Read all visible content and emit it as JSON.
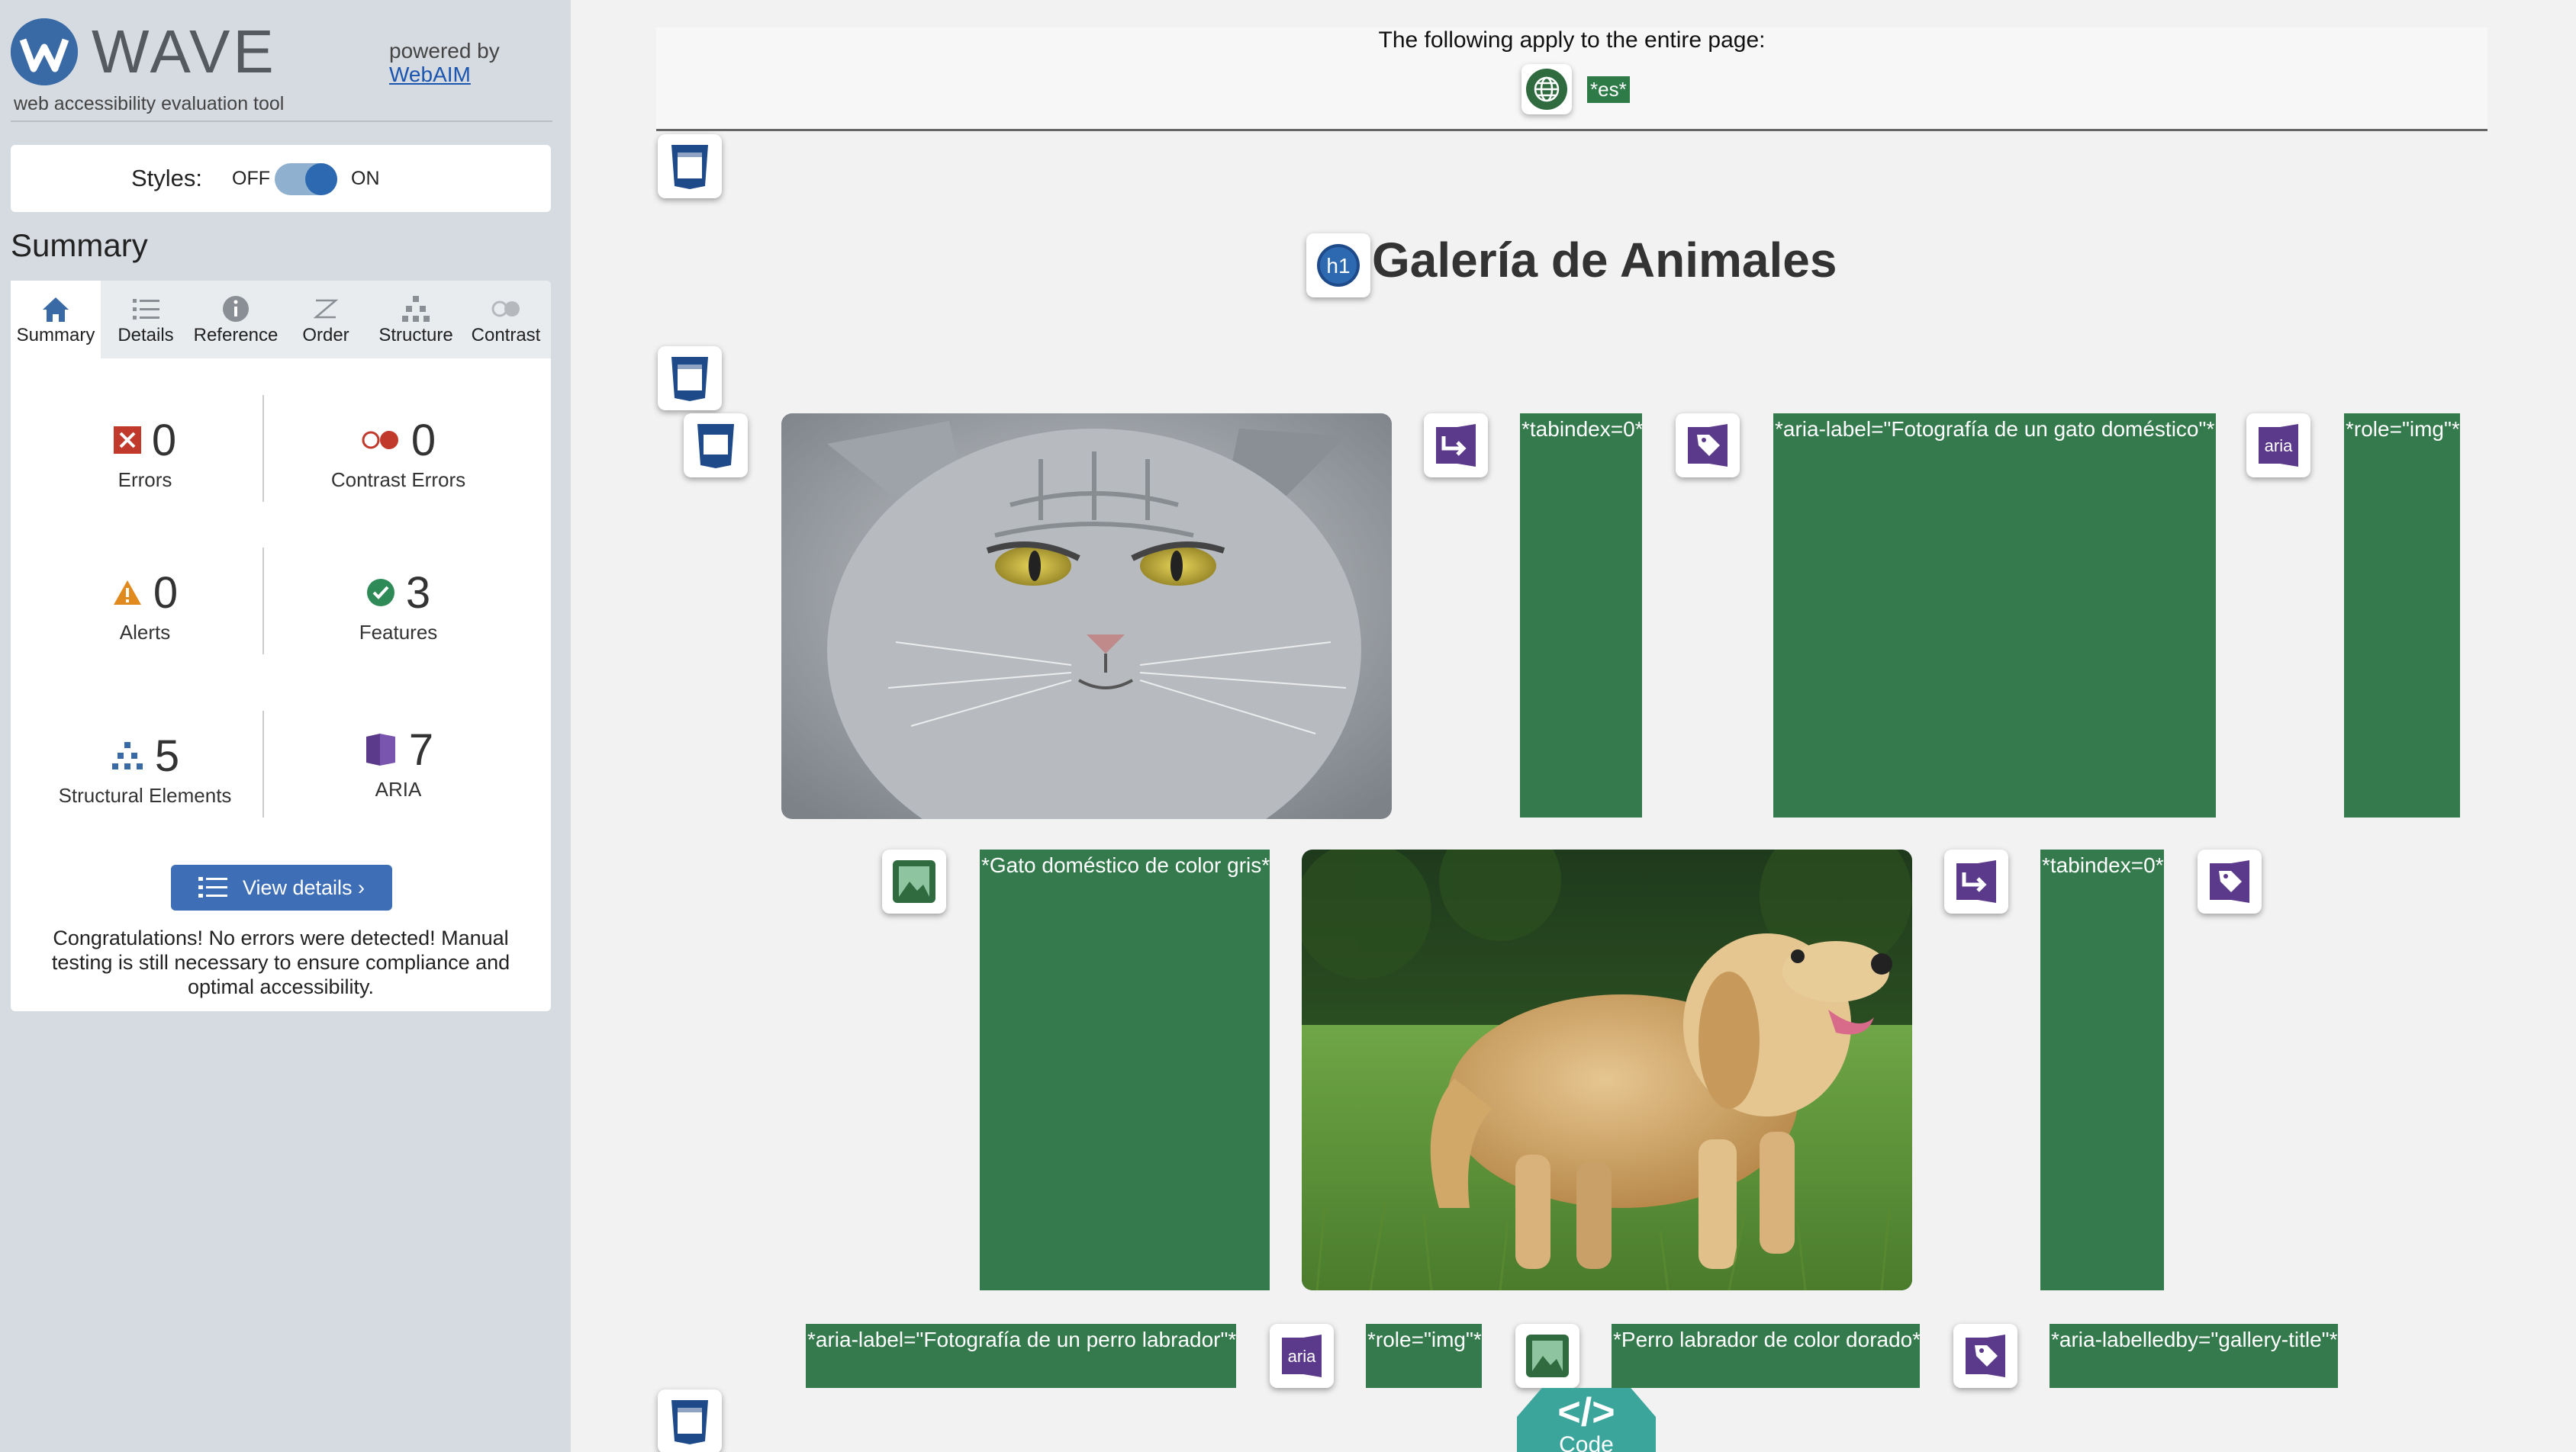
{
  "sidebar": {
    "logo_word": "WAVE",
    "tagline": "web accessibility evaluation tool",
    "powered_by": "powered by",
    "powered_link": "WebAIM",
    "styles_label": "Styles:",
    "toggle_off": "OFF",
    "toggle_on": "ON",
    "summary_heading": "Summary",
    "tabs": [
      {
        "label": "Summary",
        "icon": "home-icon"
      },
      {
        "label": "Details",
        "icon": "list-icon"
      },
      {
        "label": "Reference",
        "icon": "info-icon"
      },
      {
        "label": "Order",
        "icon": "order-icon"
      },
      {
        "label": "Structure",
        "icon": "structure-icon"
      },
      {
        "label": "Contrast",
        "icon": "contrast-icon"
      }
    ],
    "stats": [
      {
        "label": "Errors",
        "value": "0",
        "icon": "error-icon",
        "color": "#c0392b"
      },
      {
        "label": "Contrast Errors",
        "value": "0",
        "icon": "contrast-error-icon",
        "color": "#c0392b"
      },
      {
        "label": "Alerts",
        "value": "0",
        "icon": "alert-icon",
        "color": "#e08a1e"
      },
      {
        "label": "Features",
        "value": "3",
        "icon": "feature-icon",
        "color": "#2e8b57"
      },
      {
        "label": "Structural Elements",
        "value": "5",
        "icon": "structure-icon",
        "color": "#3a6aa6"
      },
      {
        "label": "ARIA",
        "value": "7",
        "icon": "aria-icon",
        "color": "#5b3a8c"
      }
    ],
    "view_details": "View details ›",
    "congrats": "Congratulations! No errors were detected! Manual testing is still necessary to ensure compliance and optimal accessibility."
  },
  "main": {
    "page_info_text": "The following apply to the entire page:",
    "lang_tag": "*es*",
    "heading_badge": "h1",
    "heading": "Galería de Animales",
    "tags": {
      "tabindex_1": "*tabindex=0*",
      "aria_label_cat": "*aria-label=\"Fotografía de un gato doméstico\"*",
      "aria_badge_1": "aria",
      "role_img_1": "*role=\"img\"*",
      "alt_cat": "*Gato doméstico de color gris*",
      "tabindex_2": "*tabindex=0*",
      "aria_label_dog": "*aria-label=\"Fotografía de un perro labrador\"*",
      "aria_badge_2": "aria",
      "role_img_2": "*role=\"img\"*",
      "alt_dog": "*Perro labrador de color dorado*",
      "aria_labelledby": "*aria-labelledby=\"gallery-title\"*"
    },
    "code_button": {
      "symbol": "</>",
      "label": "Code"
    }
  },
  "colors": {
    "tag_green": "#347a4c",
    "aria_purple": "#5b3a8c",
    "structure_navy": "#1f4a8a",
    "code_teal": "#3ba59c"
  }
}
